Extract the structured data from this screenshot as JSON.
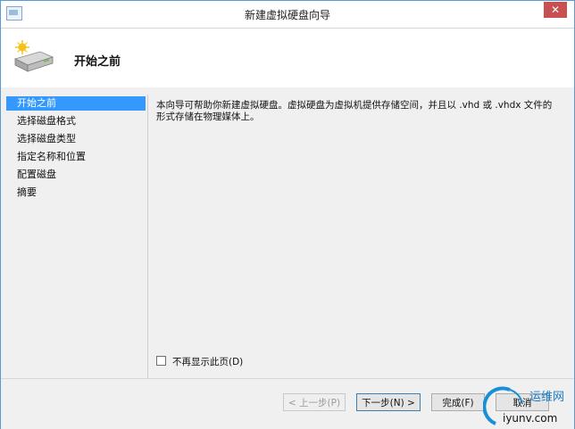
{
  "window": {
    "title": "新建虚拟硬盘向导",
    "close_glyph": "✕"
  },
  "header": {
    "title": "开始之前",
    "icon": "hard-disk-new-icon"
  },
  "nav": {
    "items": [
      {
        "label": "开始之前",
        "selected": true
      },
      {
        "label": "选择磁盘格式",
        "selected": false
      },
      {
        "label": "选择磁盘类型",
        "selected": false
      },
      {
        "label": "指定名称和位置",
        "selected": false
      },
      {
        "label": "配置磁盘",
        "selected": false
      },
      {
        "label": "摘要",
        "selected": false
      }
    ]
  },
  "content": {
    "description": "本向导可帮助你新建虚拟硬盘。虚拟硬盘为虚拟机提供存储空间，并且以 .vhd 或 .vhdx 文件的形式存储在物理媒体上。",
    "dont_show_label": "不再显示此页(D)",
    "dont_show_checked": false
  },
  "buttons": {
    "previous": "< 上一步(P)",
    "next": "下一步(N) >",
    "finish": "完成(F)",
    "cancel": "取消"
  },
  "watermark": {
    "brand": "运维网",
    "domain": "iyunv.com"
  },
  "colors": {
    "selection": "#3399ff",
    "close": "#c75050",
    "border": "#5b9bd5"
  }
}
